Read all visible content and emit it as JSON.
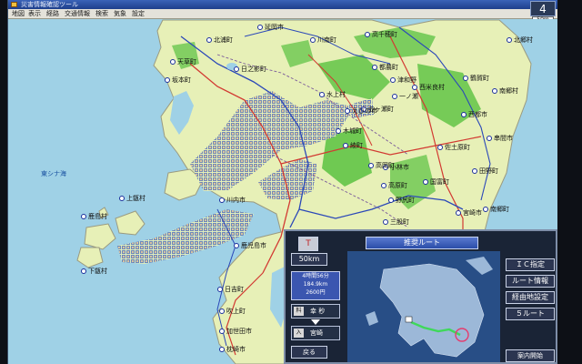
{
  "window": {
    "title": "災害情報確認ツール"
  },
  "menu": [
    "地図",
    "表示",
    "経路",
    "交通情報",
    "検索",
    "気象",
    "設定"
  ],
  "nav_chip": "4",
  "scale_box": "50m",
  "map": {
    "places": [
      {
        "id": "kitaura",
        "label": "北浦町"
      },
      {
        "id": "nobeoka",
        "label": "延岡市"
      },
      {
        "id": "tenso",
        "label": "天草町"
      },
      {
        "id": "sakamoto",
        "label": "坂本町"
      },
      {
        "id": "higoshi",
        "label": "日之影町"
      },
      {
        "id": "takachiho",
        "label": "高千穂町"
      },
      {
        "id": "kawanami",
        "label": "川南町"
      },
      {
        "id": "saito",
        "label": "西都市"
      },
      {
        "id": "tsunomachi",
        "label": "都農町"
      },
      {
        "id": "mizuki",
        "label": "水上村"
      },
      {
        "id": "gokase",
        "label": "五ヶ瀬町"
      },
      {
        "id": "tsuwano",
        "label": "津和野"
      },
      {
        "id": "ichinose",
        "label": "一ノ瀬"
      },
      {
        "id": "tsuruga",
        "label": "鶴賀町"
      },
      {
        "id": "kushima",
        "label": "串間市"
      },
      {
        "id": "tano",
        "label": "田野町"
      },
      {
        "id": "takaharu",
        "label": "高原町"
      },
      {
        "id": "sendai",
        "label": "川内市"
      },
      {
        "id": "mimata",
        "label": "三股町"
      },
      {
        "id": "kagoshima",
        "label": "鹿児島市"
      },
      {
        "id": "kamikoshiki",
        "label": "上甑村"
      },
      {
        "id": "kashima",
        "label": "鹿島村"
      },
      {
        "id": "shimokoshiki",
        "label": "下甑村"
      },
      {
        "id": "hiyoshi",
        "label": "日吉町"
      },
      {
        "id": "fukiage",
        "label": "吹上町"
      },
      {
        "id": "kaseda",
        "label": "加世田市"
      },
      {
        "id": "makurazaki",
        "label": "枕崎市"
      },
      {
        "id": "minamigo",
        "label": "南郷町"
      },
      {
        "id": "kobayashi",
        "label": "小林市"
      },
      {
        "id": "ebino",
        "label": "えびの市"
      },
      {
        "id": "nishimera",
        "label": "西米良村"
      },
      {
        "id": "sadowara",
        "label": "佐土原町"
      },
      {
        "id": "kijo",
        "label": "木城町"
      },
      {
        "id": "aya",
        "label": "綾町"
      },
      {
        "id": "takaoka",
        "label": "高岡町"
      },
      {
        "id": "nojiri",
        "label": "野尻町"
      },
      {
        "id": "kunitomi",
        "label": "国富町"
      },
      {
        "id": "nangoson",
        "label": "南郷村"
      },
      {
        "id": "kitago",
        "label": "北郷村"
      },
      {
        "id": "miyazaki",
        "label": "宮崎市"
      }
    ],
    "sea_label": "東シナ海"
  },
  "nav_panel": {
    "tower_icon": "T",
    "scale": "50km",
    "route_title": "推奨ルート",
    "route_info": [
      "4時間56分",
      "184.9km",
      "2600円"
    ],
    "guide_rows": [
      {
        "icon": "料",
        "label": "幸 秒"
      },
      {
        "icon": "入",
        "label": "宮崎"
      }
    ],
    "back_button": "戻る",
    "side_buttons": [
      "ＩＣ指定",
      "ルート情報",
      "経由地設定",
      "５ルート"
    ],
    "bottom_button": "案内開始"
  }
}
